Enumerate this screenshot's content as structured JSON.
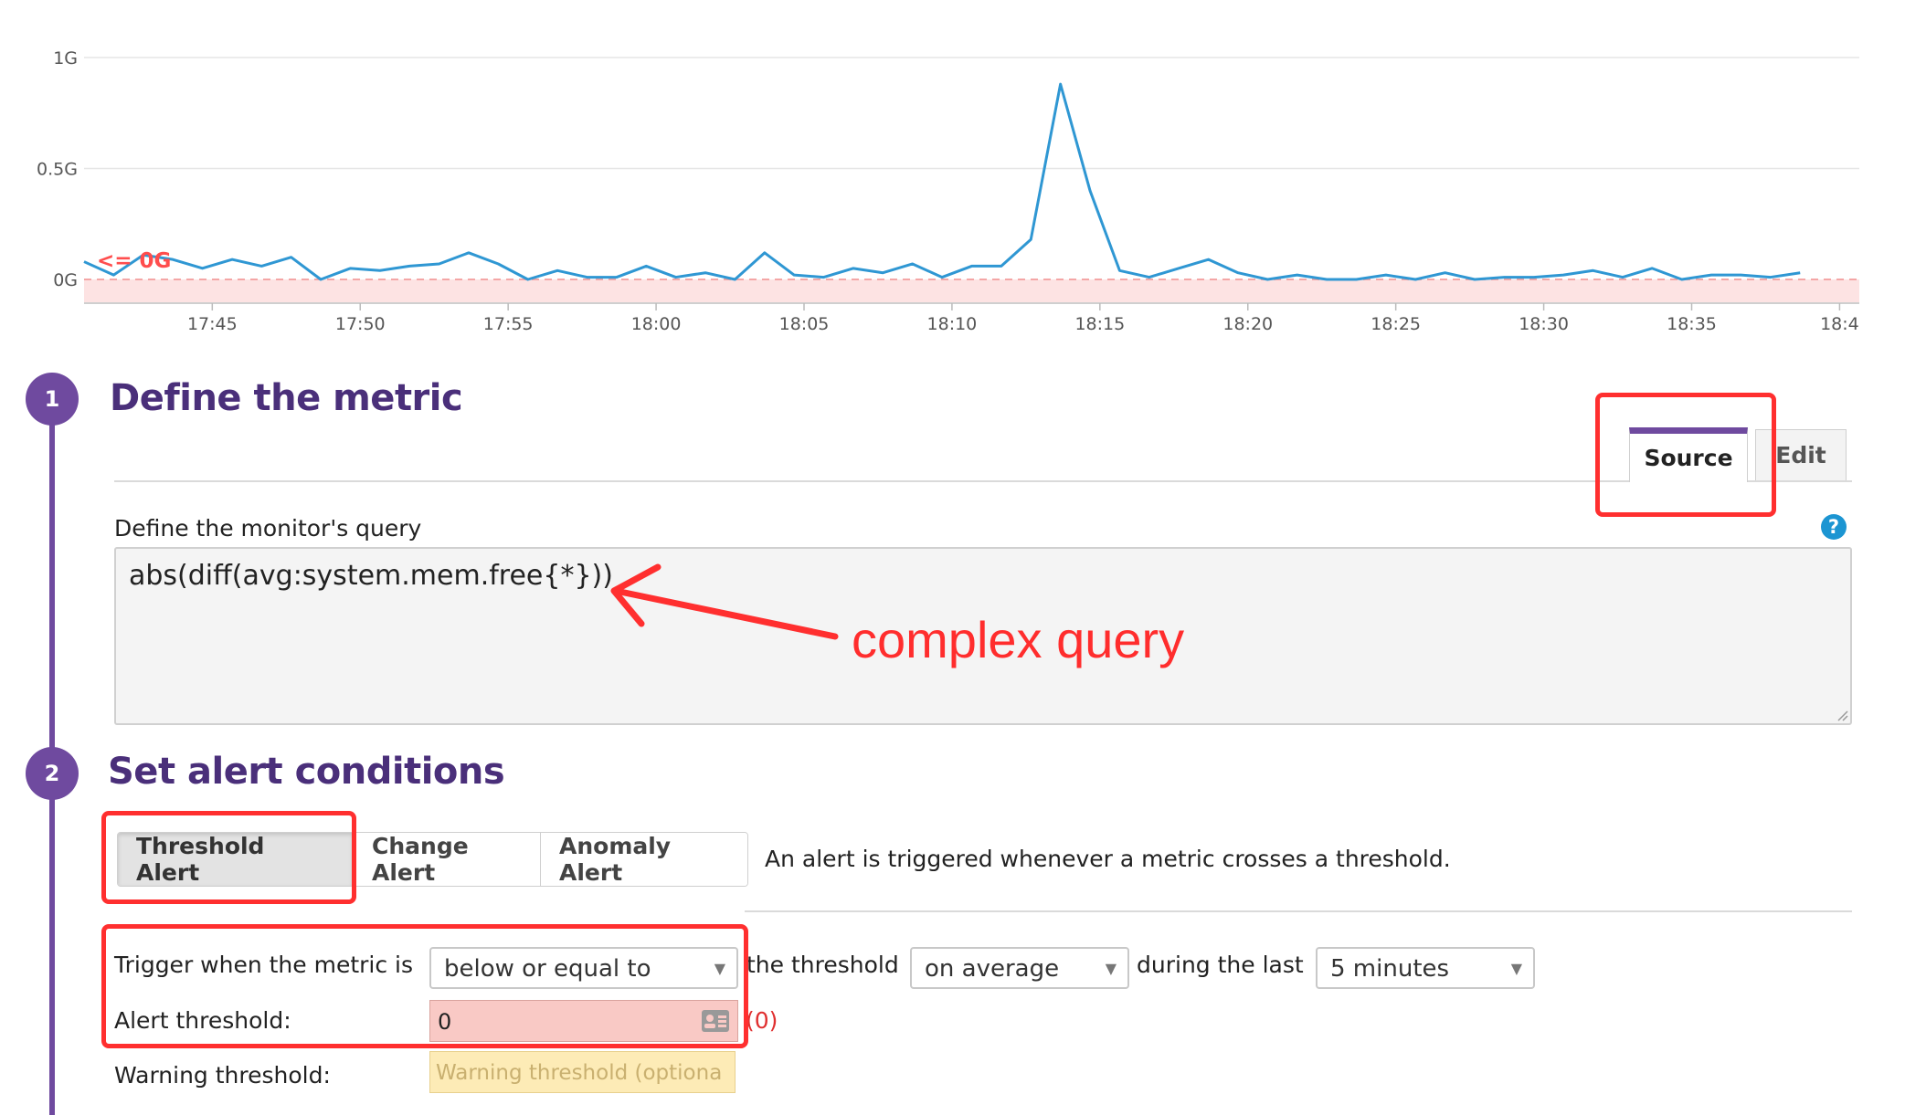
{
  "chart_data": {
    "type": "line",
    "x": [
      "17:40:40",
      "17:41:40",
      "17:42:40",
      "17:43:40",
      "17:44:40",
      "17:45:40",
      "17:46:40",
      "17:47:40",
      "17:48:40",
      "17:49:40",
      "17:50:40",
      "17:51:40",
      "17:52:40",
      "17:53:40",
      "17:54:40",
      "17:55:40",
      "17:56:40",
      "17:57:40",
      "17:58:40",
      "17:59:40",
      "18:00:40",
      "18:01:40",
      "18:02:40",
      "18:03:40",
      "18:04:40",
      "18:05:40",
      "18:06:40",
      "18:07:40",
      "18:08:40",
      "18:09:40",
      "18:10:40",
      "18:11:40",
      "18:12:40",
      "18:13:40",
      "18:14:40",
      "18:15:40",
      "18:16:40",
      "18:17:40",
      "18:18:40",
      "18:19:40",
      "18:20:40",
      "18:21:40",
      "18:22:40",
      "18:23:40",
      "18:24:40",
      "18:25:40",
      "18:26:40",
      "18:27:40",
      "18:28:40",
      "18:29:40",
      "18:30:40",
      "18:31:40",
      "18:32:40",
      "18:33:40",
      "18:34:40",
      "18:35:40",
      "18:36:40",
      "18:37:40",
      "18:38:40",
      "18:39:40",
      "18:40:40"
    ],
    "values": [
      0.08,
      0.02,
      0.11,
      0.09,
      0.05,
      0.09,
      0.06,
      0.1,
      0.0,
      0.05,
      0.04,
      0.06,
      0.07,
      0.12,
      0.07,
      0.0,
      0.04,
      0.01,
      0.01,
      0.06,
      0.01,
      0.03,
      0.0,
      0.12,
      0.02,
      0.01,
      0.05,
      0.03,
      0.07,
      0.01,
      0.06,
      0.06,
      0.18,
      0.88,
      0.4,
      0.04,
      0.01,
      0.05,
      0.09,
      0.03,
      0.0,
      0.02,
      0.0,
      0.0,
      0.02,
      0.0,
      0.03,
      0.0,
      0.01,
      0.01,
      0.02,
      0.04,
      0.01,
      0.05,
      0.0,
      0.02,
      0.02,
      0.01,
      0.03
    ],
    "x_ticks": [
      "17:45",
      "17:50",
      "17:55",
      "18:00",
      "18:05",
      "18:10",
      "18:15",
      "18:20",
      "18:25",
      "18:30",
      "18:35",
      "18:4"
    ],
    "y_ticks": [
      "1G",
      "0.5G",
      "0G"
    ],
    "ylim": [
      -0.1,
      1.0
    ],
    "grid": true,
    "color": "#2f97d3",
    "threshold": {
      "label": "<= 0G",
      "value": 0,
      "region_color": "#fde3e3",
      "line_color": "#f4a6a6"
    }
  },
  "step1": {
    "number": "1",
    "title": "Define the metric",
    "tabs": {
      "source": "Source",
      "edit": "Edit"
    },
    "query_label": "Define the monitor's query",
    "query_value": "abs(diff(avg:system.mem.free{*}))",
    "help": "?"
  },
  "annotation": "complex query",
  "step2": {
    "number": "2",
    "title": "Set alert conditions",
    "alert_types": [
      "Threshold Alert",
      "Change Alert",
      "Anomaly Alert"
    ],
    "alert_description": "An alert is triggered whenever a metric crosses a threshold.",
    "trigger_label": "Trigger when the metric is",
    "comparison": "below or equal to",
    "threshold_text": "the threshold",
    "aggregation": "on average",
    "during_text": "during the last",
    "window": "5 minutes",
    "alert_threshold_label": "Alert threshold:",
    "alert_threshold_value": "0",
    "alert_threshold_echo": "(0)",
    "warning_threshold_label": "Warning threshold:",
    "warning_threshold_placeholder": "Warning threshold (optiona"
  },
  "colors": {
    "accent": "#6f4a9f",
    "annotation": "#ff2f2f",
    "series": "#2f97d3"
  }
}
